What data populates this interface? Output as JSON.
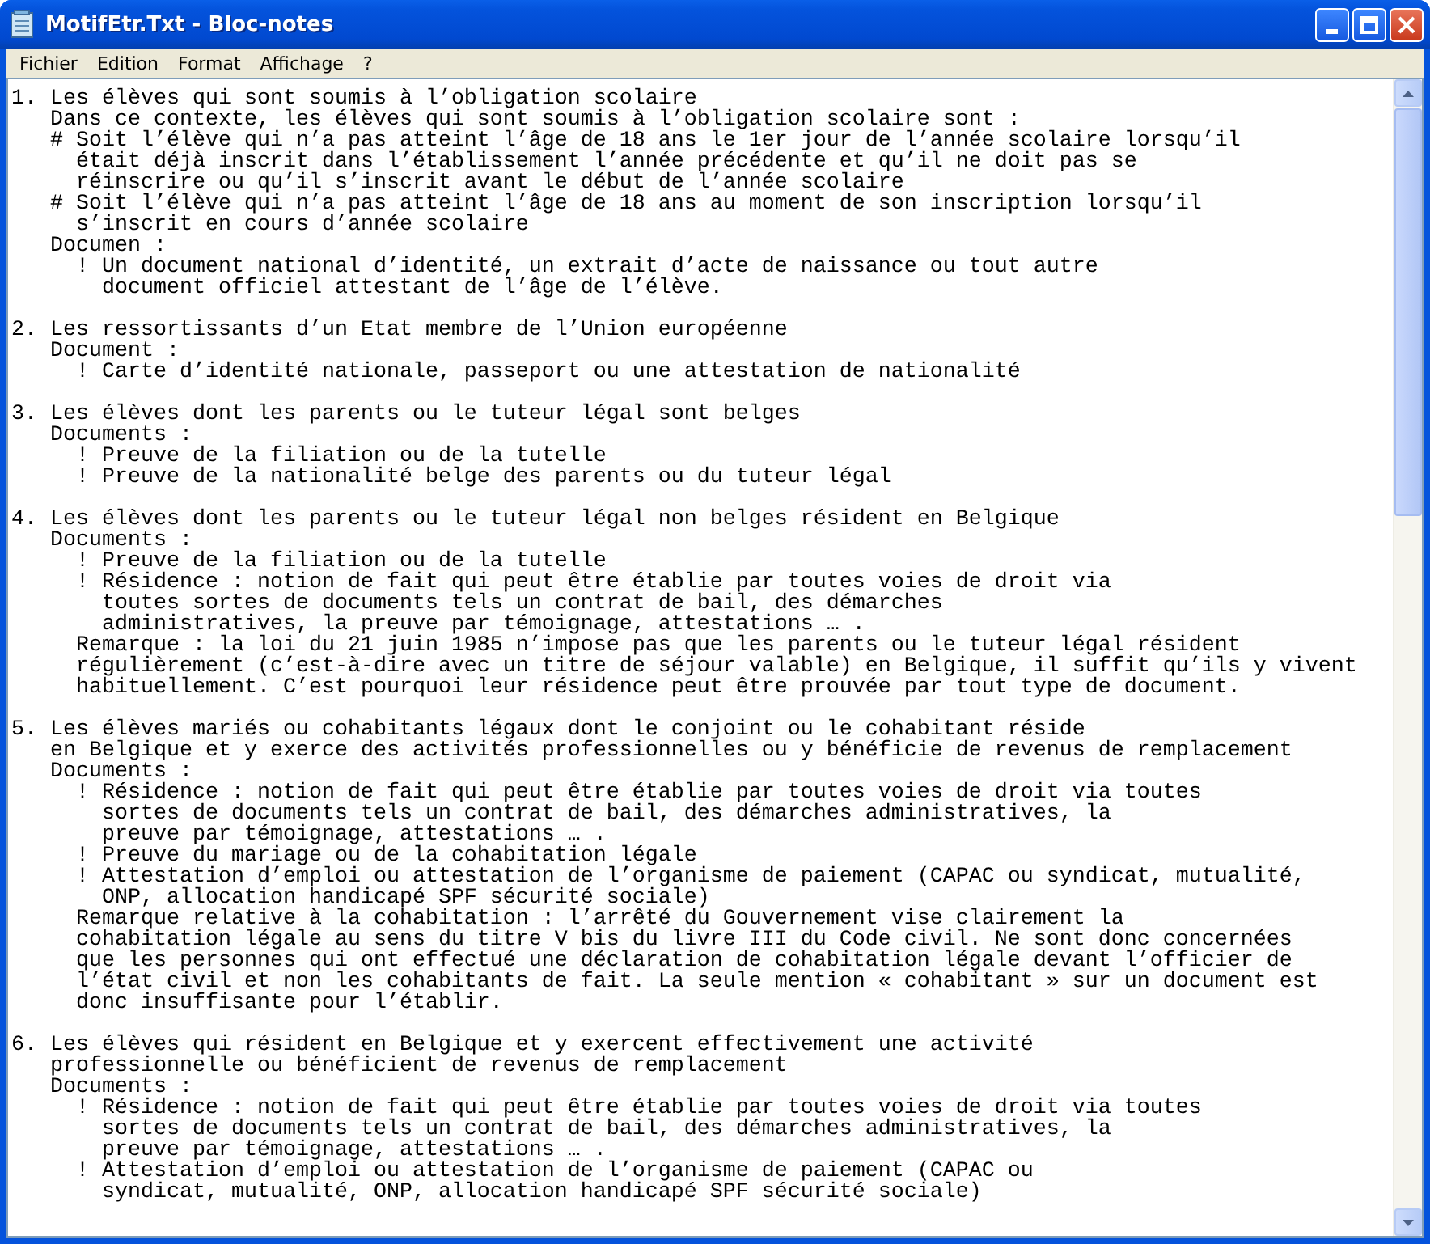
{
  "window": {
    "title": "MotifEtr.Txt - Bloc-notes"
  },
  "menu": [
    "Fichier",
    "Edition",
    "Format",
    "Affichage",
    "?"
  ],
  "document": {
    "paragraphs": [
      {
        "lines": [
          "1. Les élèves qui sont soumis à l’obligation scolaire",
          "   Dans ce contexte, les élèves qui sont soumis à l’obligation scolaire sont :",
          "   # Soit l’élève qui n’a pas atteint l’âge de 18 ans le 1er jour de l’année scolaire lorsqu’il",
          "     était déjà inscrit dans l’établissement l’année précédente et qu’il ne doit pas se",
          "     réinscrire ou qu’il s’inscrit avant le début de l’année scolaire",
          "   # Soit l’élève qui n’a pas atteint l’âge de 18 ans au moment de son inscription lorsqu’il",
          "     s’inscrit en cours d’année scolaire",
          "   Documen :",
          "     ! Un document national d’identité, un extrait d’acte de naissance ou tout autre",
          "       document officiel attestant de l’âge de l’élève."
        ]
      },
      {
        "lines": [
          "2. Les ressortissants d’un Etat membre de l’Union européenne",
          "   Document :",
          "     ! Carte d’identité nationale, passeport ou une attestation de nationalité"
        ]
      },
      {
        "lines": [
          "3. Les élèves dont les parents ou le tuteur légal sont belges",
          "   Documents :",
          "     ! Preuve de la filiation ou de la tutelle",
          "     ! Preuve de la nationalité belge des parents ou du tuteur légal"
        ]
      },
      {
        "lines": [
          "4. Les élèves dont les parents ou le tuteur légal non belges résident en Belgique",
          "   Documents :",
          "     ! Preuve de la filiation ou de la tutelle",
          "     ! Résidence : notion de fait qui peut être établie par toutes voies de droit via",
          "       toutes sortes de documents tels un contrat de bail, des démarches",
          "       administratives, la preuve par témoignage, attestations … .",
          "     Remarque : la loi du 21 juin 1985 n’impose pas que les parents ou le tuteur légal résident",
          "     régulièrement (c’est-à-dire avec un titre de séjour valable) en Belgique, il suffit qu’ils y vivent",
          "     habituellement. C’est pourquoi leur résidence peut être prouvée par tout type de document."
        ]
      },
      {
        "lines": [
          "5. Les élèves mariés ou cohabitants légaux dont le conjoint ou le cohabitant réside",
          "   en Belgique et y exerce des activités professionnelles ou y bénéficie de revenus de remplacement",
          "   Documents :",
          "     ! Résidence : notion de fait qui peut être établie par toutes voies de droit via toutes",
          "       sortes de documents tels un contrat de bail, des démarches administratives, la",
          "       preuve par témoignage, attestations … .",
          "     ! Preuve du mariage ou de la cohabitation légale",
          "     ! Attestation d’emploi ou attestation de l’organisme de paiement (CAPAC ou syndicat, mutualité,",
          "       ONP, allocation handicapé SPF sécurité sociale)",
          "     Remarque relative à la cohabitation : l’arrêté du Gouvernement vise clairement la",
          "     cohabitation légale au sens du titre V bis du livre III du Code civil. Ne sont donc concernées",
          "     que les personnes qui ont effectué une déclaration de cohabitation légale devant l’officier de",
          "     l’état civil et non les cohabitants de fait. La seule mention « cohabitant » sur un document est",
          "     donc insuffisante pour l’établir."
        ]
      },
      {
        "lines": [
          "6. Les élèves qui résident en Belgique et y exercent effectivement une activité",
          "   professionnelle ou bénéficient de revenus de remplacement",
          "   Documents :",
          "     ! Résidence : notion de fait qui peut être établie par toutes voies de droit via toutes",
          "       sortes de documents tels un contrat de bail, des démarches administratives, la",
          "       preuve par témoignage, attestations … .",
          "     ! Attestation d’emploi ou attestation de l’organisme de paiement (CAPAC ou",
          "       syndicat, mutualité, ONP, allocation handicapé SPF sécurité sociale)"
        ]
      }
    ]
  }
}
